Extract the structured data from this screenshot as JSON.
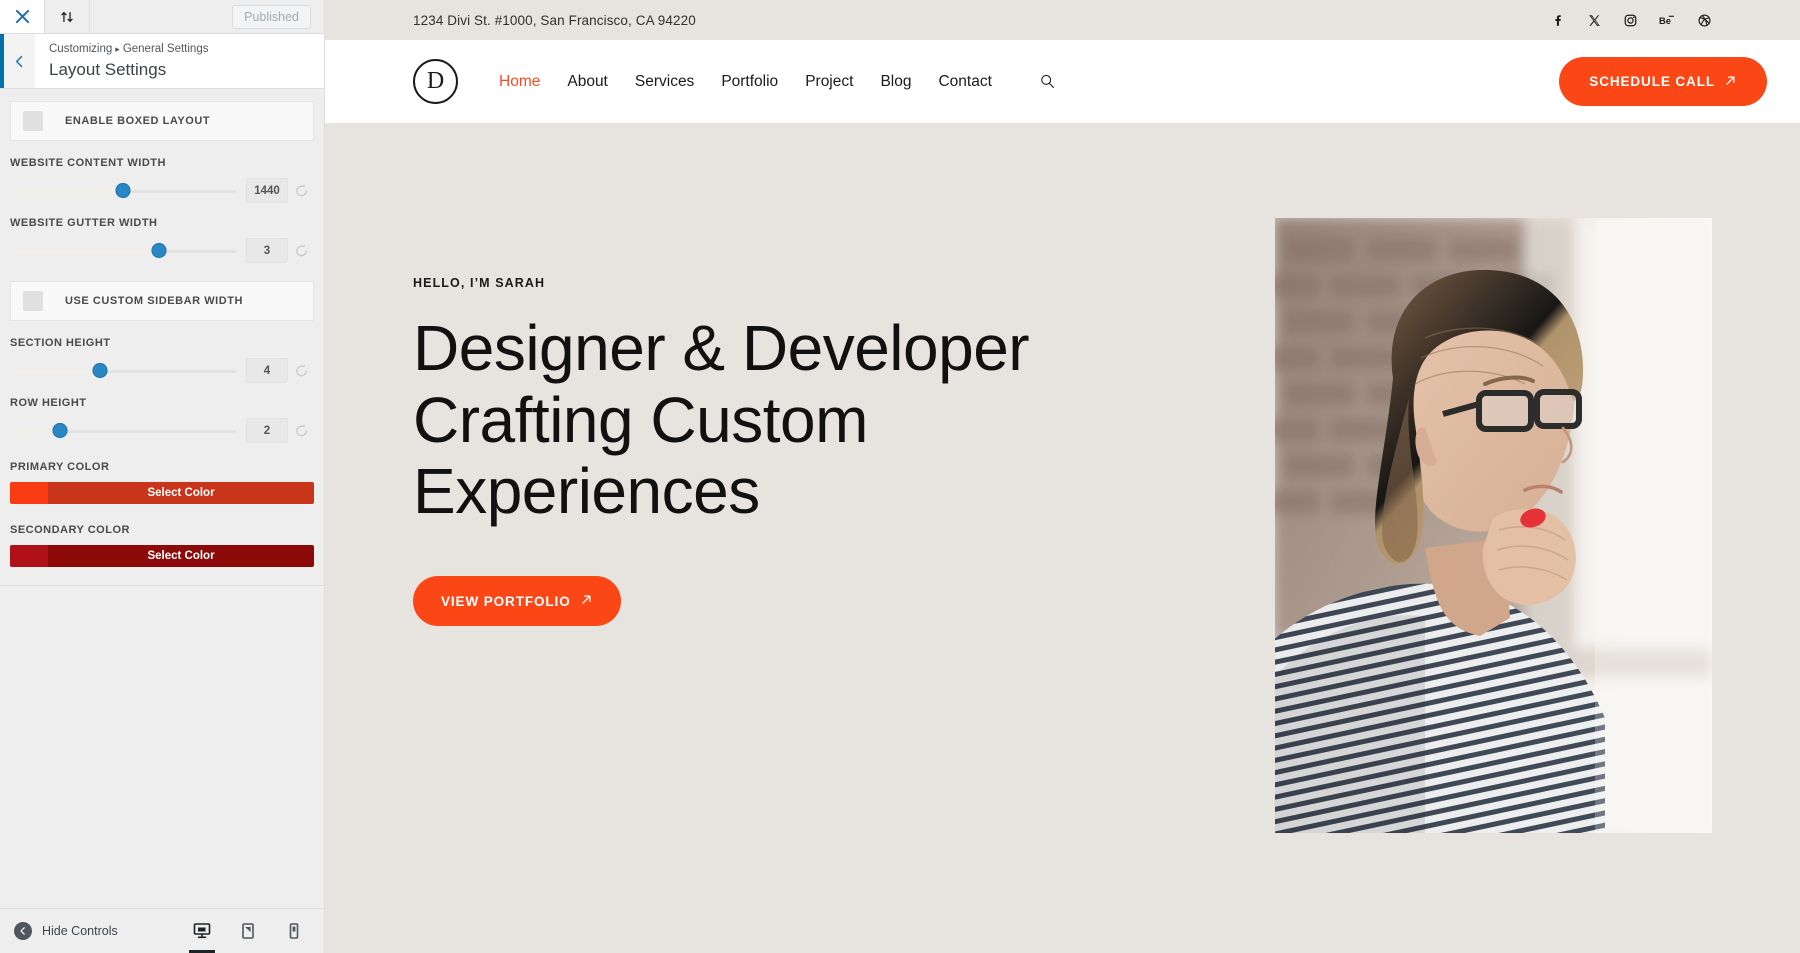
{
  "customizer": {
    "topbar": {
      "close_icon": "close-icon",
      "devices_icon": "sort-arrows-icon",
      "published_label": "Published"
    },
    "header": {
      "back_icon": "chevron-left-icon",
      "breadcrumb_root": "Customizing",
      "breadcrumb_separator": "▸",
      "breadcrumb_parent": "General Settings",
      "panel_title": "Layout Settings"
    },
    "controls": [
      {
        "type": "toggle",
        "name": "enable-boxed-layout",
        "label": "ENABLE BOXED LAYOUT",
        "checked": false
      },
      {
        "type": "slider",
        "name": "website-content-width",
        "label": "WEBSITE CONTENT WIDTH",
        "value": "1440",
        "percent": 50,
        "reset_icon": "reset-icon"
      },
      {
        "type": "slider",
        "name": "website-gutter-width",
        "label": "WEBSITE GUTTER WIDTH",
        "value": "3",
        "percent": 66,
        "reset_icon": "reset-icon"
      },
      {
        "type": "toggle",
        "name": "use-custom-sidebar-width",
        "label": "USE CUSTOM SIDEBAR WIDTH",
        "checked": false
      },
      {
        "type": "slider",
        "name": "section-height",
        "label": "SECTION HEIGHT",
        "value": "4",
        "percent": 40,
        "reset_icon": "reset-icon"
      },
      {
        "type": "slider",
        "name": "row-height",
        "label": "ROW HEIGHT",
        "value": "2",
        "percent": 22,
        "reset_icon": "reset-icon"
      },
      {
        "type": "color",
        "name": "primary-color",
        "label": "PRIMARY COLOR",
        "button_label": "Select Color",
        "swatch": "#f93b13",
        "bar": "#c9351a"
      },
      {
        "type": "color",
        "name": "secondary-color",
        "label": "SECONDARY COLOR",
        "button_label": "Select Color",
        "swatch": "#b01118",
        "bar": "#8d0a0a"
      }
    ],
    "footer": {
      "hide_controls_label": "Hide Controls",
      "hide_icon": "collapse-arrow-icon",
      "devices": [
        {
          "name": "desktop-preview",
          "icon": "desktop-icon",
          "active": true
        },
        {
          "name": "tablet-preview",
          "icon": "tablet-icon",
          "active": false
        },
        {
          "name": "mobile-preview",
          "icon": "mobile-icon",
          "active": false
        }
      ]
    }
  },
  "site": {
    "topbar": {
      "address": "1234 Divi St. #1000, San Francisco, CA 94220",
      "socials": [
        {
          "name": "facebook-icon",
          "label": "Facebook"
        },
        {
          "name": "x-twitter-icon",
          "label": "X"
        },
        {
          "name": "instagram-icon",
          "label": "Instagram"
        },
        {
          "name": "behance-icon",
          "label": "Behance"
        },
        {
          "name": "dribbble-icon",
          "label": "Dribbble"
        }
      ]
    },
    "header": {
      "logo_letter": "D",
      "nav": [
        {
          "label": "Home",
          "active": true
        },
        {
          "label": "About",
          "active": false
        },
        {
          "label": "Services",
          "active": false
        },
        {
          "label": "Portfolio",
          "active": false
        },
        {
          "label": "Project",
          "active": false
        },
        {
          "label": "Blog",
          "active": false
        },
        {
          "label": "Contact",
          "active": false
        }
      ],
      "search_icon": "search-icon",
      "cta_label": "SCHEDULE CALL",
      "cta_icon": "arrow-up-right-icon",
      "cta_color": "#fb4616"
    },
    "hero": {
      "eyebrow": "HELLO, I’M SARAH",
      "title_line1": "Designer & Developer",
      "title_line2": "Crafting Custom",
      "title_line3": "Experiences",
      "cta_label": "VIEW PORTFOLIO",
      "cta_icon": "arrow-up-right-icon",
      "cta_color": "#fb4616",
      "background": "#e7e3de",
      "photo_alt": "Woman with glasses in a striped shirt looking out a window"
    }
  }
}
